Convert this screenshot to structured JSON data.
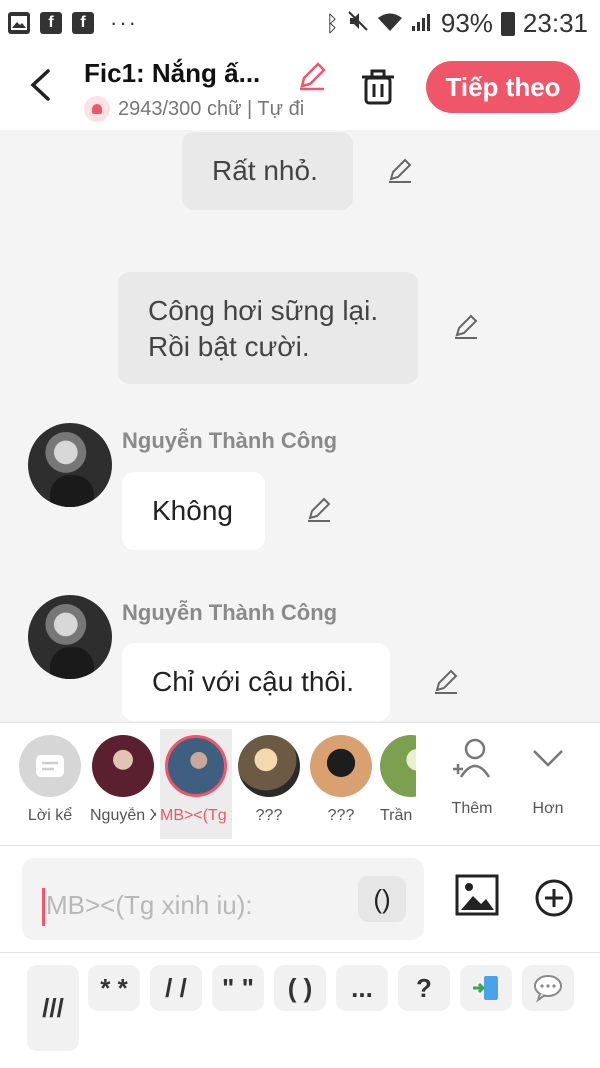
{
  "status_bar": {
    "left_icons": [
      "gallery-icon",
      "facebook-icon",
      "facebook-icon"
    ],
    "dots": "···",
    "battery": "93%",
    "time": "23:31"
  },
  "header": {
    "back_icon": "chevron-left-icon",
    "title": "Fic1: Nắng ấ...",
    "subtitle": "2943/300 chữ | Tự đi",
    "next_button": "Tiếp theo",
    "accent_color": "#f0566a"
  },
  "messages": [
    {
      "type": "narration",
      "text": "Rất nhỏ."
    },
    {
      "type": "narration",
      "text": "Công hơi sững lại.\nRồi bật cười."
    },
    {
      "type": "character",
      "sender": "Nguyễn Thành Công",
      "text": "Không"
    },
    {
      "type": "character",
      "sender": "Nguyễn Thành Công",
      "text": "Chỉ với cậu thôi."
    }
  ],
  "characters": [
    {
      "label": "Lời kể"
    },
    {
      "label": "Nguyễn X..."
    },
    {
      "label": "MB><(Tg x..."
    },
    {
      "label": "???"
    },
    {
      "label": "???"
    },
    {
      "label": "Trần T"
    }
  ],
  "character_actions": {
    "add_label": "Thêm",
    "more_label": "Hơn"
  },
  "composer": {
    "placeholder": "MB><(Tg xinh iu):",
    "paren_button": "()"
  },
  "quick_keys": [
    "///",
    "* *",
    "/ /",
    "\" \"",
    "( )",
    "...",
    "?"
  ]
}
